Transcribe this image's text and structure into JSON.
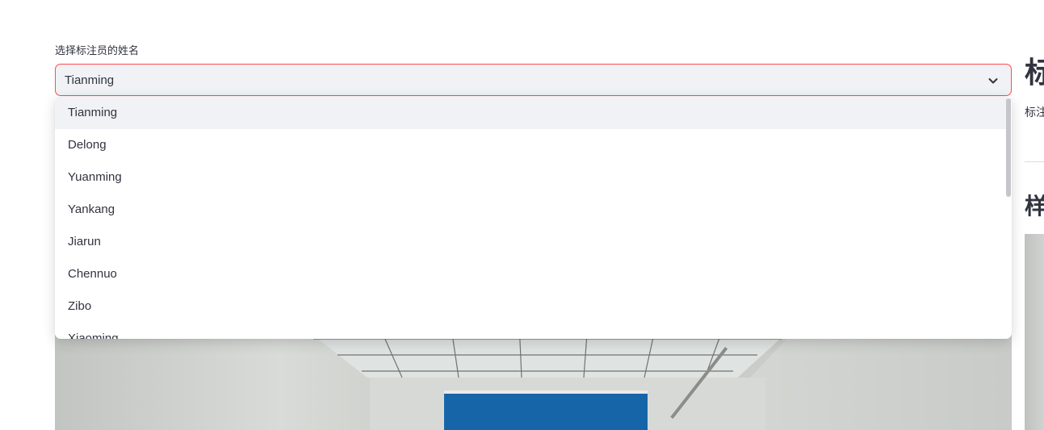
{
  "select": {
    "label": "选择标注员的姓名",
    "value": "Tianming",
    "chevron_icon": "chevron-down-icon",
    "options": [
      "Tianming",
      "Delong",
      "Yuanming",
      "Yankang",
      "Jiarun",
      "Chennuo",
      "Zibo",
      "Xiaoming"
    ]
  },
  "right_panel": {
    "title": "标",
    "caption": "标注",
    "subtitle": "样"
  },
  "colors": {
    "accent": "#ff4b4b",
    "select_bg": "#f0f2f6",
    "text": "#31333f",
    "blind": "#1565a8"
  }
}
